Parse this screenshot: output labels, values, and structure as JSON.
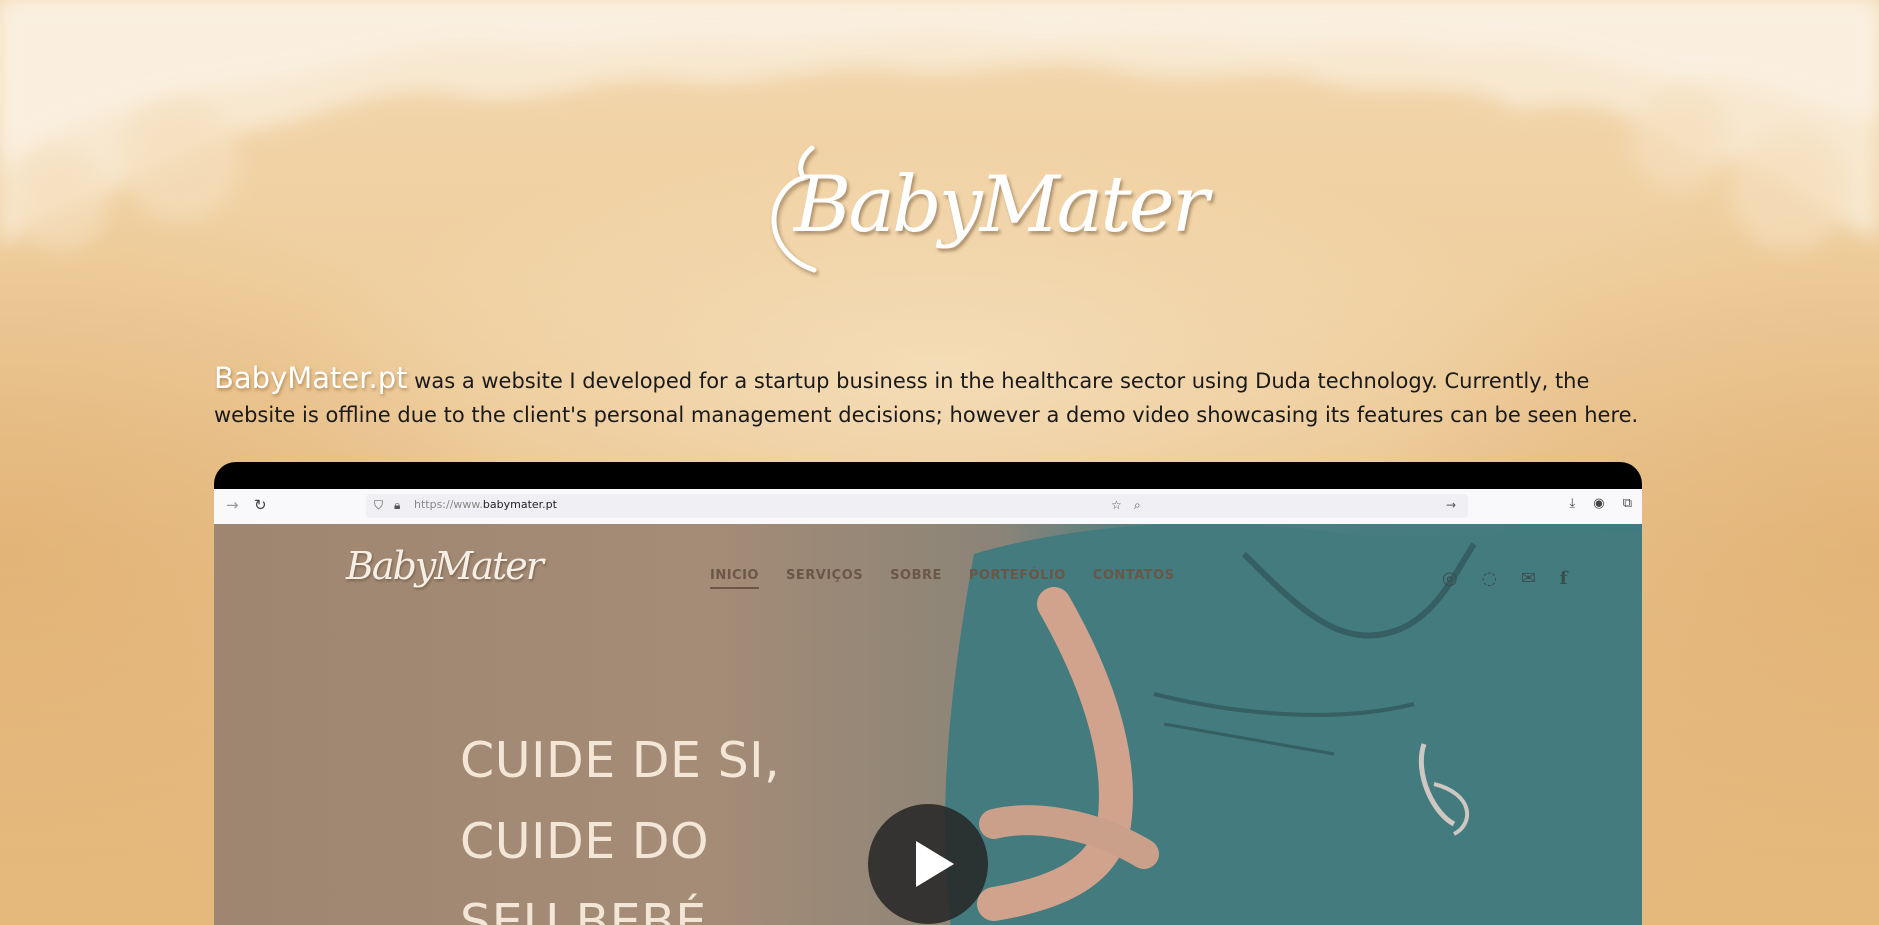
{
  "logo": {
    "text": "BabyMater"
  },
  "intro": {
    "brand": "BabyMater.pt",
    "text": " was a website I developed for a startup business in the healthcare sector using Duda technology. Currently, the website is offline due to the client's personal management decisions; however a demo video showcasing its features can be seen here."
  },
  "video": {
    "browser": {
      "url_prefix": "https://www.",
      "url_domain": "babymater.pt"
    },
    "site": {
      "logo": "BabyMater",
      "nav": [
        "INICIO",
        "SERVIÇOS",
        "SOBRE",
        "PORTEFÓLIO",
        "CONTATOS"
      ],
      "hero_lines": [
        "CUIDE DE SI,",
        "CUIDE DO",
        "SEU BEBÉ,"
      ]
    },
    "play_label": "Play"
  },
  "colors": {
    "background": "#efcf9f",
    "text": "#1a1a1a",
    "brand_text": "#ffffff",
    "scrubs": "#3f7b80"
  }
}
